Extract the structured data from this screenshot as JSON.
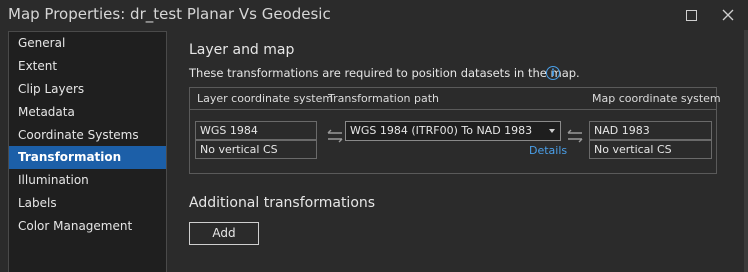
{
  "window": {
    "title": "Map Properties: dr_test Planar Vs Geodesic",
    "maximize_icon": "maximize-icon",
    "close_icon": "close-icon"
  },
  "sidebar": {
    "items": [
      {
        "label": "General",
        "active": false
      },
      {
        "label": "Extent",
        "active": false
      },
      {
        "label": "Clip Layers",
        "active": false
      },
      {
        "label": "Metadata",
        "active": false
      },
      {
        "label": "Coordinate Systems",
        "active": false
      },
      {
        "label": "Transformation",
        "active": true
      },
      {
        "label": "Illumination",
        "active": false
      },
      {
        "label": "Labels",
        "active": false
      },
      {
        "label": "Color Management",
        "active": false
      }
    ]
  },
  "main": {
    "section_title": "Layer and map",
    "info_text": "These transformations are required to position datasets in the map.",
    "info_icon": "info-icon",
    "table": {
      "headers": [
        "Layer coordinate system",
        "Transformation path",
        "Map coordinate system"
      ],
      "layer_cs": "WGS 1984",
      "layer_vertical": "No vertical CS",
      "transformation": "WGS 1984 (ITRF00) To NAD 1983",
      "details_link": "Details",
      "map_cs": "NAD 1983",
      "map_vertical": "No vertical CS"
    },
    "additional_title": "Additional transformations",
    "add_button": "Add"
  },
  "colors": {
    "accent": "#1c5fa8",
    "link": "#4a9fe8",
    "background": "#2b2b2b",
    "sidebar_bg": "#1f1f1f"
  }
}
